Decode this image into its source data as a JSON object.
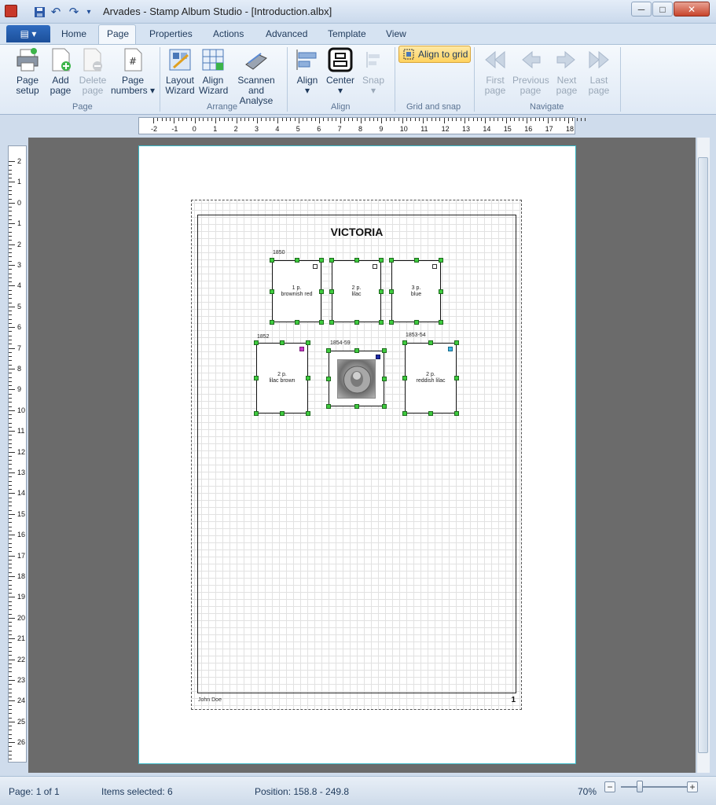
{
  "window": {
    "title": "Arvades - Stamp Album Studio - [Introduction.albx]",
    "minimize": "─",
    "maximize": "□",
    "close": "✕"
  },
  "quick_access": [
    "save-icon",
    "undo-icon",
    "redo-icon",
    "customize-icon"
  ],
  "tabs": {
    "file": "▤ ▾",
    "items": [
      "Home",
      "Page",
      "Properties",
      "Actions",
      "Advanced",
      "Template",
      "View"
    ],
    "active": "Page"
  },
  "ribbon": {
    "page_group": {
      "label": "Page",
      "page_setup": "Page setup",
      "add_page": "Add page",
      "delete_page": "Delete page",
      "page_numbers": "Page numbers ▾"
    },
    "arrange_group": {
      "label": "Arrange",
      "layout_wizard": "Layout Wizard",
      "align_wizard": "Align Wizard",
      "scan_analyse": "Scannen and Analyse"
    },
    "align_group": {
      "label": "Align",
      "align": "Align ▾",
      "center": "Center ▾",
      "snap": "Snap ▾"
    },
    "grid_group": {
      "label": "Grid and snap",
      "align_to_grid": "Align to grid"
    },
    "navigate_group": {
      "label": "Navigate",
      "first_page": "First page",
      "previous_page": "Previous page",
      "next_page": "Next page",
      "last_page": "Last page"
    }
  },
  "ruler": {
    "h_ticks": [
      "-2",
      "-1",
      "0",
      "1",
      "2",
      "3",
      "4",
      "5",
      "6",
      "7",
      "8",
      "9",
      "10",
      "11",
      "12",
      "13",
      "14",
      "15",
      "16",
      "17",
      "18"
    ],
    "v_ticks": [
      "2",
      "1",
      "0",
      "1",
      "2",
      "3",
      "4",
      "5",
      "6",
      "7",
      "8",
      "9",
      "10",
      "11",
      "12",
      "13",
      "14",
      "15",
      "16",
      "17",
      "18",
      "19",
      "20",
      "21",
      "22",
      "23",
      "24",
      "25",
      "26",
      "27"
    ]
  },
  "album_page": {
    "title": "VICTORIA",
    "footer_name": "John Doe",
    "page_number": "1",
    "row1": {
      "year": "1850",
      "stamps": [
        {
          "denomination": "1 p.",
          "color": "brownish red"
        },
        {
          "denomination": "2 p.",
          "color": "lilac"
        },
        {
          "denomination": "3 p.",
          "color": "blue"
        }
      ]
    },
    "row2": [
      {
        "year": "1852",
        "denomination": "2 p.",
        "color": "lilac brown",
        "marker_color": "#c83cc8"
      },
      {
        "year": "1854-59",
        "image": "stamp-image",
        "marker_color": "#1c2ca8"
      },
      {
        "year": "1853-54",
        "denomination": "2 p.",
        "color": "reddish lilac",
        "marker_color": "#3cb8e6"
      }
    ]
  },
  "status": {
    "page": "Page: 1 of 1",
    "selected": "Items selected: 6",
    "position": "Position: 158.8 - 249.8",
    "zoom": "70%",
    "zoom_minus": "−",
    "zoom_plus": "+"
  }
}
